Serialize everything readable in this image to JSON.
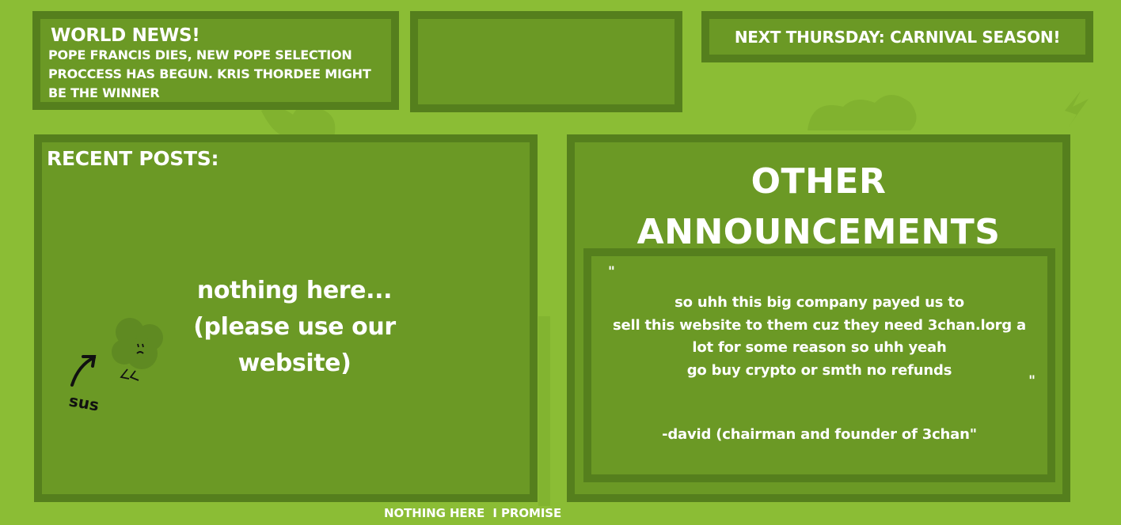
{
  "colors": {
    "background": "#8bbd35",
    "panel_fill": "#6b9925",
    "panel_border": "#557f1d",
    "text": "#ffffff"
  },
  "world_news": {
    "title": "WORLD NEWS!",
    "body": "POPE FRANCIS DIES, NEW POPE SELECTION PROCCESS HAS BEGUN. KRIS THORDEE MIGHT BE THE WINNER"
  },
  "next_event": {
    "text": "NEXT THURSDAY: CARNIVAL SEASON!"
  },
  "recent_posts": {
    "title": "RECENT POSTS:",
    "empty_message": "nothing here... (please use our website)",
    "mascot_icon": "clover-mascot-icon",
    "doodle_caption": "sus"
  },
  "announcements": {
    "title": "OTHER ANNOUNCEMENTS",
    "open_quote": "\"",
    "lines": [
      "so uhh this big company payed us to",
      "sell this website to them cuz they need 3chan.lorg a",
      "lot for some reason so uhh yeah",
      "go buy crypto or smth no refunds"
    ],
    "close_quote": "\"",
    "signature": "-david (chairman and founder of 3chan\""
  },
  "footer": {
    "text": "NOTHING HERE  I PROMISE"
  }
}
